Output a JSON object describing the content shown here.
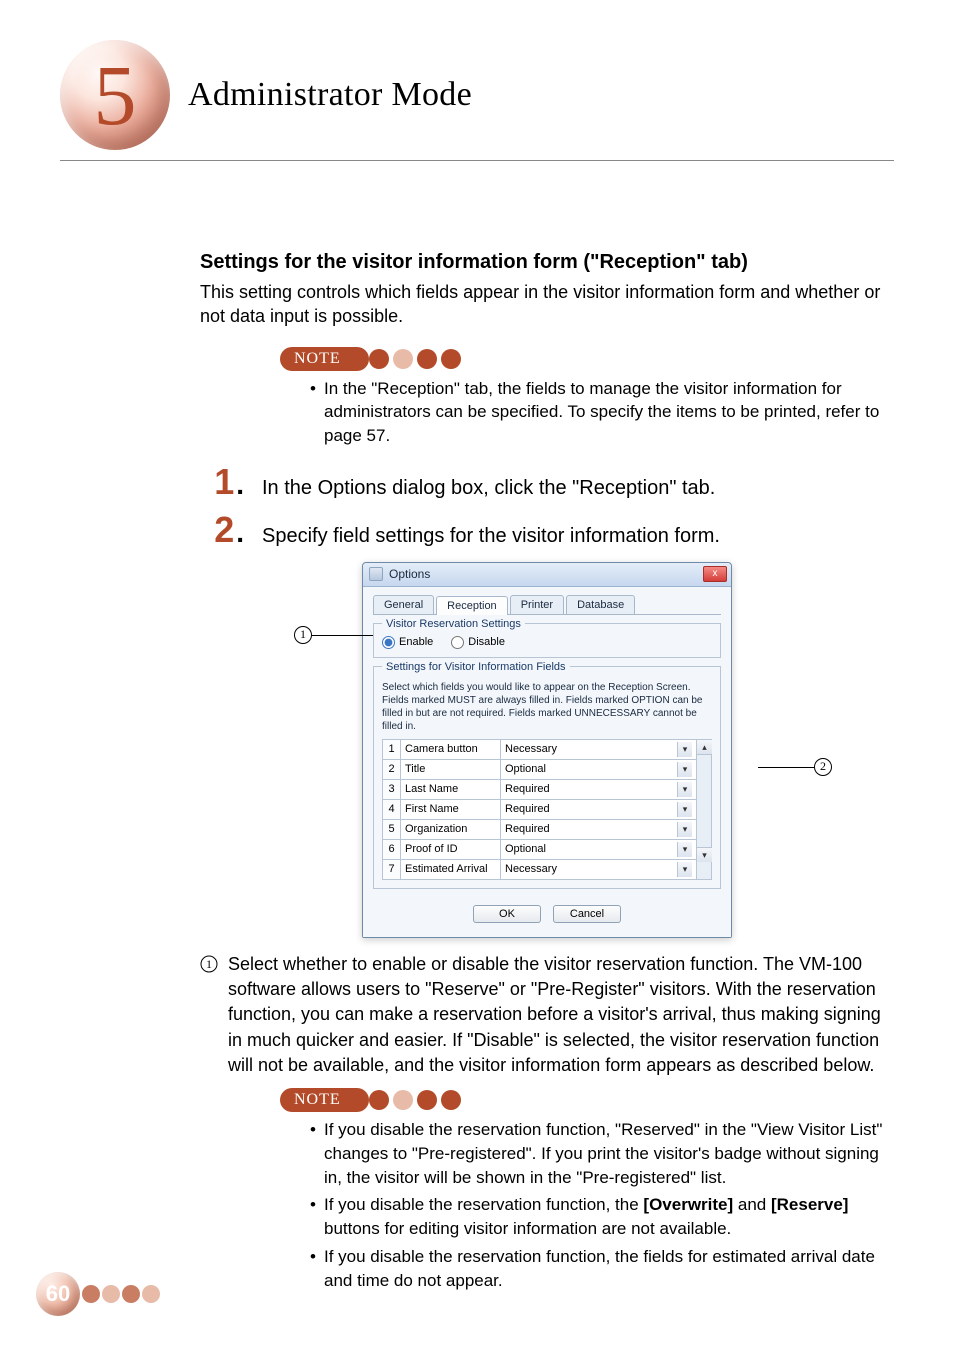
{
  "chapter": {
    "number": "5",
    "title": "Administrator Mode"
  },
  "section": {
    "title": "Settings for the visitor information form (\"Reception\" tab)",
    "intro": "This setting controls which fields appear in the visitor information form and whether or not data input is possible."
  },
  "note_label": "NOTE",
  "note1": {
    "items": [
      "In the \"Reception\" tab, the fields to manage the visitor information for administrators can be specified. To specify the items to be printed, refer to page 57."
    ]
  },
  "steps": {
    "s1": {
      "num": "1",
      "text": "In the Options dialog box, click the \"Reception\" tab."
    },
    "s2": {
      "num": "2",
      "text": "Specify field settings for the visitor information form."
    }
  },
  "dialog": {
    "title": "Options",
    "close": "x",
    "tabs": {
      "general": "General",
      "reception": "Reception",
      "printer": "Printer",
      "database": "Database"
    },
    "group1": {
      "title": "Visitor Reservation Settings",
      "enable": "Enable",
      "disable": "Disable",
      "selected": "enable"
    },
    "group2": {
      "title": "Settings for Visitor Information Fields",
      "desc": "Select which fields you would like to appear on the Reception Screen.  Fields marked MUST are always filled in. Fields marked OPTION can be filled in but are not required. Fields marked UNNECESSARY cannot be filled in.",
      "rows": [
        {
          "n": "1",
          "field": "Camera button",
          "value": "Necessary"
        },
        {
          "n": "2",
          "field": "Title",
          "value": "Optional"
        },
        {
          "n": "3",
          "field": "Last Name",
          "value": "Required"
        },
        {
          "n": "4",
          "field": "First Name",
          "value": "Required"
        },
        {
          "n": "5",
          "field": "Organization",
          "value": "Required"
        },
        {
          "n": "6",
          "field": "Proof of ID",
          "value": "Optional"
        },
        {
          "n": "7",
          "field": "Estimated Arrival",
          "value": "Necessary"
        }
      ]
    },
    "ok": "OK",
    "cancel": "Cancel"
  },
  "enum1": {
    "text": "Select whether to enable or disable the visitor reservation function. The VM-100 software allows users to \"Reserve\" or \"Pre-Register\" visitors. With the reservation function, you can make a reservation before a visitor's arrival, thus making signing in much quicker and easier. If \"Disable\" is selected, the visitor reservation function will not be available, and the visitor information form appears as described below."
  },
  "note2": {
    "items": [
      "If you disable the reservation function, \"Reserved\" in the \"View Visitor List\" changes to \"Pre-registered\". If you print the visitor's badge without signing in, the visitor will be shown in the \"Pre-registered\" list.",
      "If you disable the reservation function, the [Overwrite] and [Reserve] buttons for editing visitor information are not available.",
      "If you disable the reservation function, the fields for estimated arrival date and time do not appear."
    ]
  },
  "note2_formatted": {
    "item2_pre": "If you disable the reservation function, the ",
    "item2_b1": "[Overwrite]",
    "item2_mid": " and ",
    "item2_b2": "[Reserve]",
    "item2_post": " buttons for editing visitor information are not available."
  },
  "page_number": "60"
}
